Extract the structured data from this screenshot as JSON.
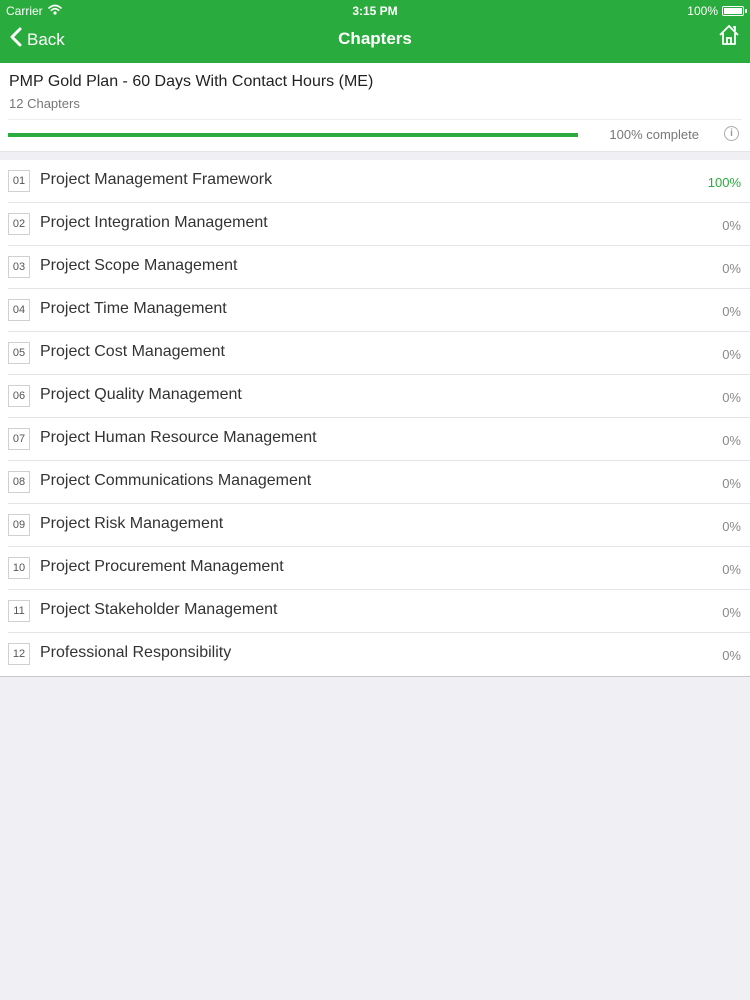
{
  "status_bar": {
    "carrier": "Carrier",
    "time": "3:15 PM",
    "battery": "100%"
  },
  "nav": {
    "back_label": "Back",
    "title": "Chapters"
  },
  "plan": {
    "title": "PMP Gold Plan - 60 Days With Contact Hours (ME)",
    "subtitle": "12 Chapters",
    "progress_percent": 100,
    "progress_label": "100% complete"
  },
  "colors": {
    "accent": "#2aab3d",
    "background": "#efeff4"
  },
  "chapters": [
    {
      "num": "01",
      "title": "Project Management Framework",
      "pct": "100%"
    },
    {
      "num": "02",
      "title": "Project Integration Management",
      "pct": "0%"
    },
    {
      "num": "03",
      "title": "Project Scope Management",
      "pct": "0%"
    },
    {
      "num": "04",
      "title": "Project Time Management",
      "pct": "0%"
    },
    {
      "num": "05",
      "title": "Project Cost Management",
      "pct": "0%"
    },
    {
      "num": "06",
      "title": "Project Quality Management",
      "pct": "0%"
    },
    {
      "num": "07",
      "title": "Project Human Resource Management",
      "pct": "0%"
    },
    {
      "num": "08",
      "title": "Project Communications Management",
      "pct": "0%"
    },
    {
      "num": "09",
      "title": "Project Risk Management",
      "pct": "0%"
    },
    {
      "num": "10",
      "title": "Project Procurement Management",
      "pct": "0%"
    },
    {
      "num": "11",
      "title": "Project Stakeholder Management",
      "pct": "0%"
    },
    {
      "num": "12",
      "title": "Professional Responsibility",
      "pct": "0%"
    }
  ]
}
